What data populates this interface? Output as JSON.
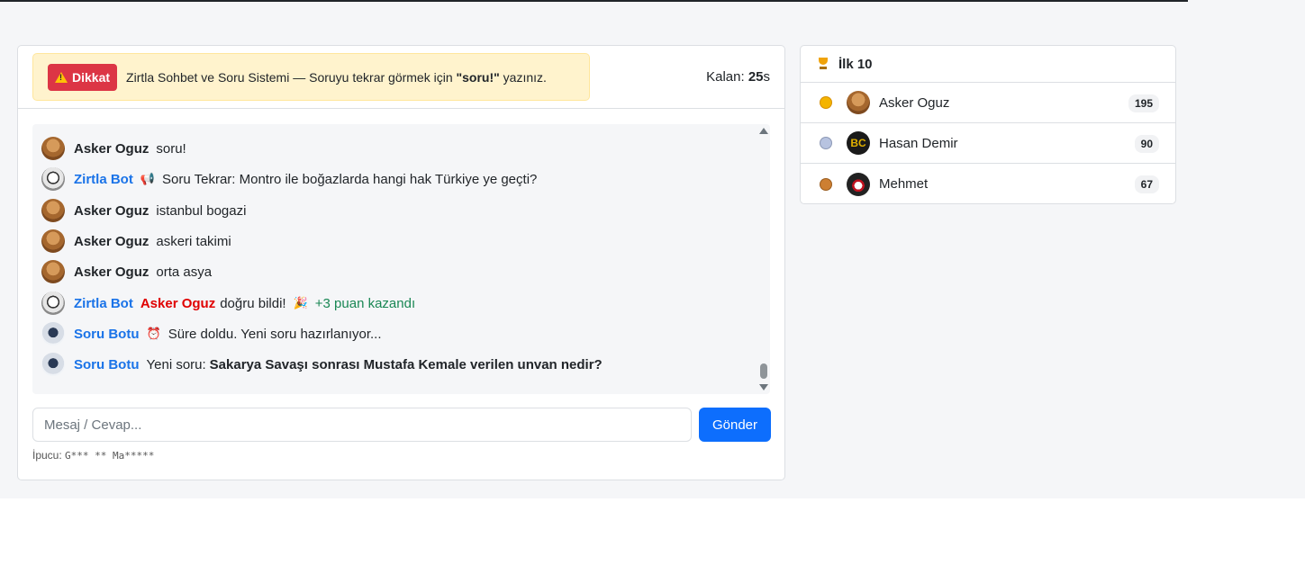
{
  "alert": {
    "badge": "Dikkat",
    "text_before": "Zirtla Sohbet ve Soru Sistemi — Soruyu tekrar görmek için ",
    "command": "\"soru!\"",
    "text_after": " yazınız."
  },
  "timer": {
    "label": "Kalan:",
    "value": "25",
    "unit": "s"
  },
  "messages": [
    {
      "author": "Asker Oguz",
      "author_type": "user",
      "text": "soru!"
    },
    {
      "author": "Zirtla Bot",
      "author_type": "bot",
      "icon": "megaphone-icon",
      "text": "Soru Tekrar: Montro ile boğazlarda hangi hak Türkiye ye geçti?"
    },
    {
      "author": "Asker Oguz",
      "author_type": "user",
      "text": "istanbul bogazi"
    },
    {
      "author": "Asker Oguz",
      "author_type": "user",
      "text": "askeri takimi"
    },
    {
      "author": "Asker Oguz",
      "author_type": "user",
      "text": "orta asya"
    },
    {
      "author": "Zirtla Bot",
      "author_type": "bot",
      "winner": "Asker Oguz",
      "text": "doğru bildi!",
      "icon": "party-icon",
      "points": "+3 puan kazandı"
    },
    {
      "author": "Soru Botu",
      "author_type": "robot",
      "icon": "alarm-clock-icon",
      "text": "Süre doldu. Yeni soru hazırlanıyor..."
    },
    {
      "author": "Soru Botu",
      "author_type": "robot",
      "prefix": "Yeni soru:",
      "question": "Sakarya Savaşı sonrası Mustafa Kemale verilen unvan nedir?"
    }
  ],
  "input": {
    "placeholder": "Mesaj / Cevap...",
    "send_label": "Gönder"
  },
  "hint": {
    "label": "İpucu:",
    "value": "G*** ** Ma*****"
  },
  "leaderboard": {
    "title": "İlk 10",
    "rows": [
      {
        "rank": 1,
        "name": "Asker Oguz",
        "score": "195",
        "avatar_text": ""
      },
      {
        "rank": 2,
        "name": "Hasan Demir",
        "score": "90",
        "avatar_text": "BC"
      },
      {
        "rank": 3,
        "name": "Mehmet",
        "score": "67",
        "avatar_text": ""
      }
    ]
  }
}
